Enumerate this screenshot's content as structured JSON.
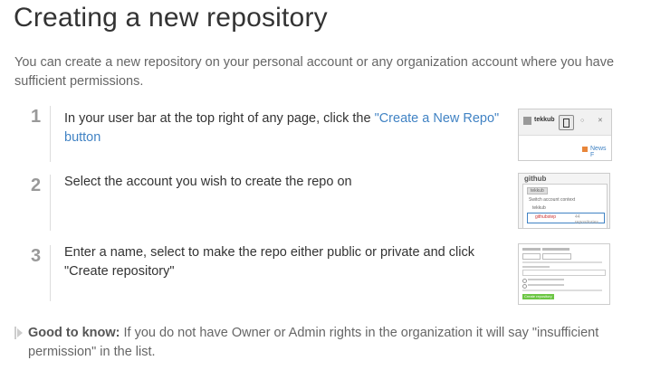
{
  "page": {
    "title": "Creating a new repository",
    "intro": "You can create a new repository on your personal account or any organization account where you have sufficient permissions."
  },
  "steps": [
    {
      "number": "1",
      "text_before": "In your user bar at the top right of any page, click the ",
      "link": "\"Create a New Repo\" button",
      "thumb": {
        "user": "tekkub",
        "news": "News F"
      }
    },
    {
      "number": "2",
      "text": "Select the account you wish to create the repo on",
      "thumb": {
        "brand": "github",
        "dropdown_title": "Switch account context",
        "user": "tekkub",
        "org": "githubstep",
        "repos": "44 repositories"
      }
    },
    {
      "number": "3",
      "text": "Enter a name, select to make the repo either public or private and click \"Create repository\"",
      "thumb": {
        "button": "Create repository"
      }
    }
  ],
  "note": {
    "label": "Good to know:",
    "text": " If you do not have Owner or Admin rights in the organization it will say \"insufficient permission\" in the list."
  },
  "colors": {
    "link": "#4183c4",
    "muted": "#666666",
    "step_number": "#999999"
  }
}
